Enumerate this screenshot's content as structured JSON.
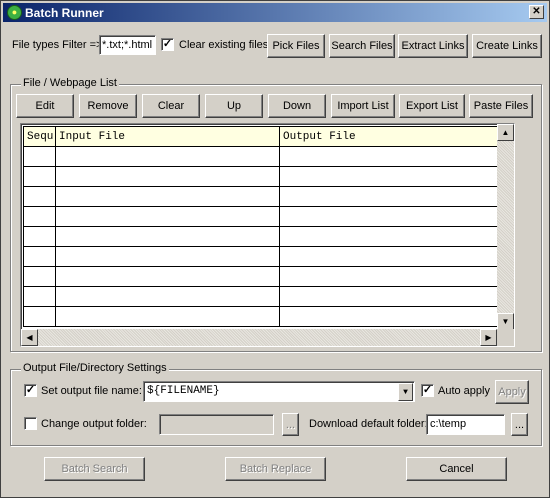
{
  "window": {
    "title": "Batch Runner",
    "close_glyph": "✕",
    "app_icon": "batch-runner-icon",
    "app_icon_glyph": "●"
  },
  "top": {
    "filter_label": "File types Filter =>",
    "filter_value": "*.txt;*.html",
    "clear_existing_label": "Clear existing files",
    "clear_existing_checked": true,
    "pick_files": "Pick Files",
    "search_files": "Search Files",
    "extract_links": "Extract Links",
    "create_links": "Create Links"
  },
  "list_group": {
    "title": "File / Webpage List",
    "buttons": {
      "edit": "Edit",
      "remove": "Remove",
      "clear": "Clear",
      "up": "Up",
      "down": "Down",
      "import_list": "Import List",
      "export_list": "Export List",
      "paste_files": "Paste Files"
    },
    "columns": [
      "Sequ",
      "Input File",
      "Output File",
      ""
    ],
    "row_count": 9
  },
  "output_group": {
    "title": "Output File/Directory Settings",
    "set_output_label": "Set output file name:",
    "set_output_checked": true,
    "output_name_value": "${FILENAME}",
    "auto_apply_label": "Auto apply",
    "auto_apply_checked": true,
    "apply_label": "Apply",
    "change_folder_label": "Change output folder:",
    "change_folder_checked": false,
    "folder_value": "",
    "browse_label": "...",
    "download_label": "Download default folder:",
    "download_value": "c:\\temp",
    "download_browse_label": "..."
  },
  "bottom": {
    "batch_search": "Batch Search",
    "batch_replace": "Batch Replace",
    "cancel": "Cancel"
  },
  "check_glyph": "✓"
}
